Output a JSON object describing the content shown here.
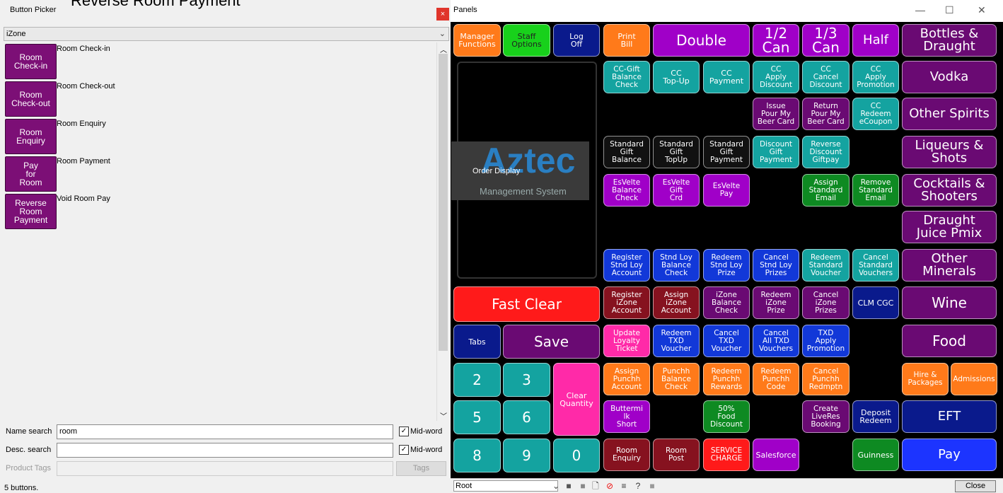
{
  "overlay_title": "Reverse Room Payment",
  "picker": {
    "title": "Button Picker",
    "zone": "iZone",
    "rows": [
      {
        "btn": "Room\nCheck-in",
        "desc": "Room Check-in"
      },
      {
        "btn": "Room\nCheck-out",
        "desc": "Room Check-out"
      },
      {
        "btn": "Room\nEnquiry",
        "desc": "Room Enquiry"
      },
      {
        "btn": "Pay\nfor\nRoom",
        "desc": "Room Payment"
      },
      {
        "btn": "Reverse\nRoom\nPayment",
        "desc": "Void Room Pay"
      }
    ],
    "name_search_label": "Name search",
    "name_search_value": "room",
    "desc_search_label": "Desc. search",
    "desc_search_value": "",
    "product_tags_label": "Product Tags",
    "midword": "Mid-word",
    "tags_btn": "Tags",
    "status": "5 buttons."
  },
  "panels": {
    "title": "Panels",
    "order_display": "Order Display",
    "logo_text": "Aztec",
    "logo_sub": "Management System",
    "root": "Root",
    "close": "Close",
    "buttons": {
      "manager": "Manager\nFunctions",
      "staff": "Staff\nOptions",
      "logoff": "Log\nOff",
      "print": "Print\nBill",
      "double": "Double",
      "half_can": "1/2\nCan",
      "third_can": "1/3\nCan",
      "half": "Half",
      "bottles": "Bottles &\nDraught",
      "ccgift": "CC-Gift\nBalance\nCheck",
      "cctopup": "CC\nTop-Up",
      "ccpay": "CC\nPayment",
      "ccapplydisc": "CC\nApply\nDiscount",
      "cccanceldisc": "CC\nCancel\nDiscount",
      "ccapplypromo": "CC\nApply\nPromotion",
      "vodka": "Vodka",
      "issuepour": "Issue\nPour My\nBeer Card",
      "returnpour": "Return\nPour My\nBeer Card",
      "ccredeem": "CC\nRedeem\neCoupon",
      "otherspirits": "Other Spirits",
      "stdgiftbal": "Standard\nGift\nBalance",
      "stdgifttop": "Standard\nGift\nTopUp",
      "stdgiftpay": "Standard\nGift\nPayment",
      "discgiftpay": "Discount\nGift\nPayment",
      "revdisc": "Reverse\nDiscount\nGiftpay",
      "liqueurs": "Liqueurs &\nShots",
      "esbal": "EsVelte\nBalance\nCheck",
      "esgift": "EsVelte\nGift\nCrd",
      "espay": "EsVelte\nPay",
      "assignstd": "Assign\nStandard\nEmail",
      "removestd": "Remove\nStandard\nEmail",
      "cocktails": "Cocktails &\nShooters",
      "draughtjuice": "Draught\nJuice Pmix",
      "regstnd": "Register\nStnd Loy\nAccount",
      "stndbal": "Stnd Loy\nBalance\nCheck",
      "redeemstnd": "Redeem\nStnd Loy\nPrize",
      "cancelstnd": "Cancel\nStnd Loy\nPrizes",
      "redeemstdv": "Redeem\nStandard\nVoucher",
      "cancelstdv": "Cancel\nStandard\nVouchers",
      "otherminerals": "Other\nMinerals",
      "fastclear": "Fast Clear",
      "regizone": "Register\niZone\nAccount",
      "assignizone": "Assign\niZone\nAccount",
      "izonebal": "iZone\nBalance\nCheck",
      "redeemizone": "Redeem\niZone\nPrize",
      "cancelizone": "Cancel\niZone\nPrizes",
      "clmcgc": "CLM CGC",
      "wine": "Wine",
      "tabs": "Tabs",
      "save": "Save",
      "updateloyalty": "Update\nLoyalty\nTicket",
      "redeemtxd": "Redeem\nTXD\nVoucher",
      "canceltxd": "Cancel\nTXD\nVoucher",
      "cancelalltxd": "Cancel\nAll TXD\nVouchers",
      "txdapply": "TXD\nApply\nPromotion",
      "food": "Food",
      "n2": "2",
      "n3": "3",
      "clearqty": "Clear\nQuantity",
      "assignpunchh": "Assign\nPunchh\nAccount",
      "punchhbal": "Punchh\nBalance\nCheck",
      "redeempunchhr": "Redeem\nPunchh\nRewards",
      "redeempunchhc": "Redeem\nPunchh\nCode",
      "cancelpunchh": "Cancel\nPunchh\nRedmptn",
      "hire": "Hire &\nPackages",
      "admissions": "Admissions",
      "n5": "5",
      "n6": "6",
      "buttermilk": "Buttermi\nlk\nShort",
      "foodDisc": "50%\nFood\nDiscount",
      "createlive": "Create\nLiveRes\nBooking",
      "deposit": "Deposit\nRedeem",
      "eft": "EFT",
      "n8": "8",
      "n9": "9",
      "n0": "0",
      "roomenq": "Room\nEnquiry",
      "roompost": "Room\nPost",
      "service": "SERVICE\nCHARGE",
      "salesforce": "Salesforce",
      "guinness": "Guinness",
      "pay": "Pay"
    }
  },
  "colors": {
    "orange": "#ff7a1a",
    "green": "#18d11b",
    "navy": "#0a1a8c",
    "purple": "#a000c8",
    "teal": "#14a3a0",
    "darkgreen": "#0e8a22",
    "maroon": "#86121f",
    "blue": "#1238d8",
    "red": "#ff1a1a",
    "pink": "#ff2aa8",
    "darkpurple": "#6a0a73",
    "black": "#111111",
    "brightblue": "#1c34ff"
  }
}
